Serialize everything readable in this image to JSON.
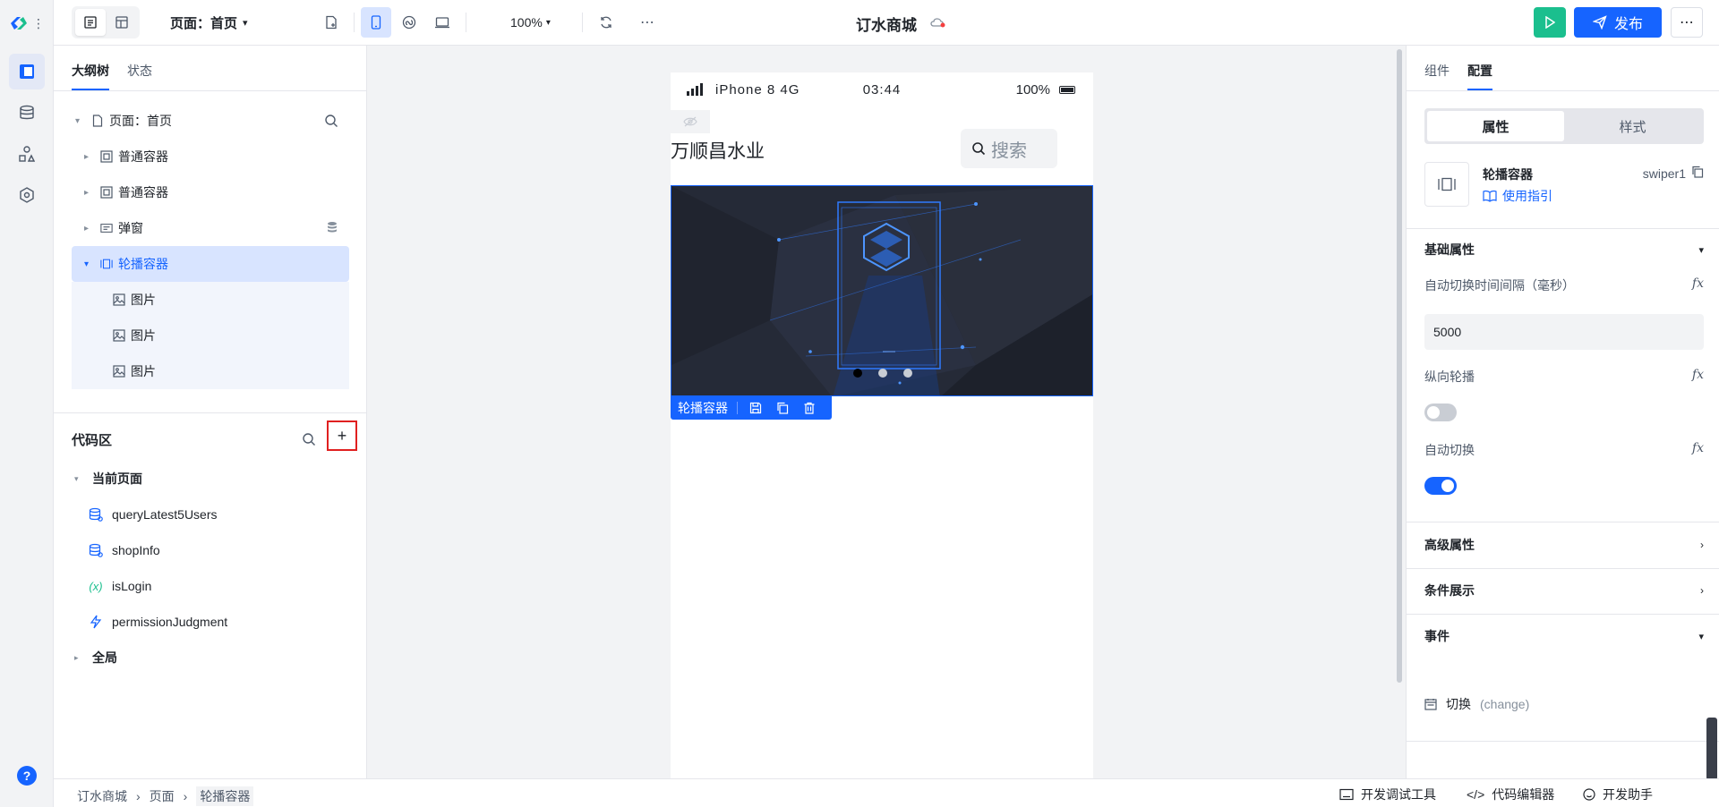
{
  "app": {
    "title": "订水商城"
  },
  "rail": {
    "items": [
      "outline-icon",
      "database-icon",
      "component-icon",
      "settings-icon"
    ],
    "help": "?"
  },
  "topbar": {
    "page_selector": "页面：首页",
    "zoom": "100%",
    "publish_label": "发布",
    "more": "⋯"
  },
  "left_panel": {
    "tabs": [
      "大纲树",
      "状态"
    ],
    "tree": [
      {
        "label": "页面：首页",
        "level": 0
      },
      {
        "label": "普通容器",
        "level": 1
      },
      {
        "label": "普通容器",
        "level": 1
      },
      {
        "label": "弹窗",
        "level": 1
      },
      {
        "label": "轮播容器",
        "level": 1
      },
      {
        "label": "图片",
        "level": 2
      },
      {
        "label": "图片",
        "level": 2
      },
      {
        "label": "图片",
        "level": 2
      }
    ],
    "code": {
      "title": "代码区",
      "add": "+",
      "groups": [
        {
          "label": "当前页面"
        },
        {
          "label": "全局"
        }
      ],
      "items": [
        {
          "label": "queryLatest5Users",
          "icon": "datasource-icon"
        },
        {
          "label": "shopInfo",
          "icon": "datasource-icon"
        },
        {
          "label": "isLogin",
          "icon": "variable-icon",
          "glyph": "(x)"
        },
        {
          "label": "permissionJudgment",
          "icon": "function-icon"
        }
      ]
    }
  },
  "canvas": {
    "status_bar": {
      "device": "iPhone 8  4G",
      "time": "03:44",
      "battery": "100%"
    },
    "shop_name": "万顺昌水业",
    "search_placeholder": "搜索",
    "selection_label": "轮播容器"
  },
  "right_panel": {
    "tabs": [
      "组件",
      "配置"
    ],
    "segment": [
      "属性",
      "样式"
    ],
    "component": {
      "name": "轮播容器",
      "id": "swiper1",
      "guide": "使用指引"
    },
    "sections": {
      "basic": "基础属性",
      "advanced": "高级属性",
      "condition": "条件展示",
      "events": "事件"
    },
    "props": {
      "interval_label": "自动切换时间间隔（毫秒）",
      "interval_value": "5000",
      "vertical_label": "纵向轮播",
      "vertical_on": false,
      "autoplay_label": "自动切换",
      "autoplay_on": true,
      "fx": "fx"
    },
    "event": {
      "name": "切换",
      "code": "(change)"
    }
  },
  "bottombar": {
    "breadcrumb": [
      "订水商城",
      "页面",
      "轮播容器"
    ],
    "devtools": "开发调试工具",
    "code_editor": "代码编辑器",
    "third": "开发助手"
  },
  "colors": {
    "primary": "#1664ff",
    "run": "#1bbf8e",
    "highlight": "#e02020"
  }
}
